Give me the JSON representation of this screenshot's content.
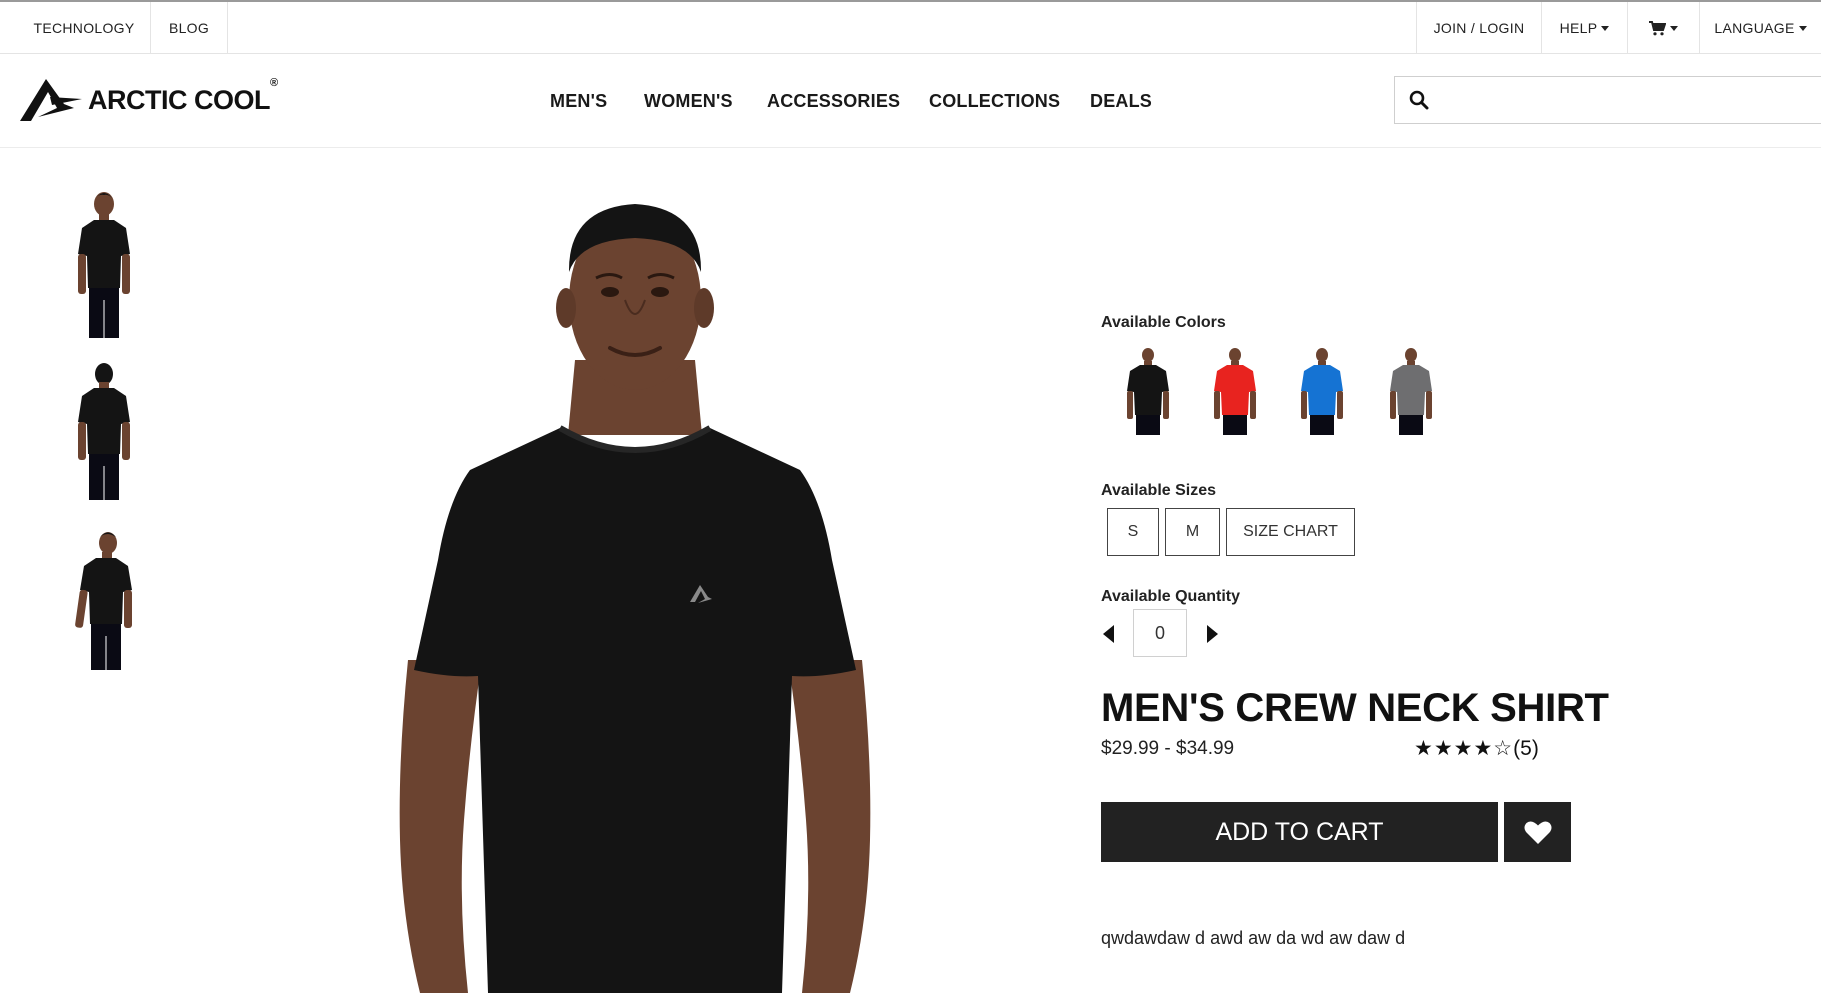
{
  "topbar": {
    "technology": "TECHNOLOGY",
    "blog": "BLOG",
    "join_login": "JOIN / LOGIN",
    "help": "HELP",
    "language": "LANGUAGE",
    "cart_icon": "cart-icon"
  },
  "header": {
    "logo_text": "ARCTIC COOL",
    "logo_mark": "®",
    "nav": [
      "MEN'S",
      "WOMEN'S",
      "ACCESSORIES",
      "COLLECTIONS",
      "DEALS"
    ],
    "search": {
      "value": "",
      "placeholder": "",
      "icon": "search-icon"
    }
  },
  "gallery": {
    "thumbnails": [
      "front-view",
      "back-view",
      "side-view"
    ],
    "shirt_color": "#141414",
    "skin_color": "#6b4330"
  },
  "product": {
    "colors_label": "Available Colors",
    "colors": [
      {
        "name": "black",
        "hex": "#141414"
      },
      {
        "name": "red",
        "hex": "#e8231f"
      },
      {
        "name": "blue",
        "hex": "#1573d3"
      },
      {
        "name": "gray",
        "hex": "#6e6e70"
      }
    ],
    "sizes_label": "Available Sizes",
    "sizes": [
      "S",
      "M",
      "SIZE CHART"
    ],
    "quantity_label": "Available Quantity",
    "quantity": "0",
    "title": "MEN'S CREW NECK SHIRT",
    "price": "$29.99 - $34.99",
    "stars": "★★★★☆",
    "rating_value": 4.5,
    "review_count": "(5)",
    "add_to_cart": "ADD TO CART",
    "wishlist_icon": "heart-icon",
    "description": "qwdawdaw d awd aw da wd aw daw d"
  },
  "colors": {
    "dark": "#222222",
    "border": "#e4e4e4"
  }
}
